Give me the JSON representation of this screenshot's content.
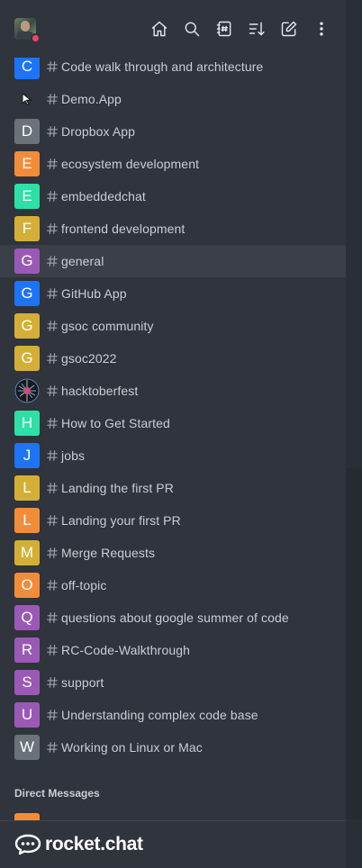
{
  "header": {
    "actions": [
      {
        "name": "home-icon"
      },
      {
        "name": "search-icon"
      },
      {
        "name": "directory-icon"
      },
      {
        "name": "sort-icon"
      },
      {
        "name": "create-new-icon"
      },
      {
        "name": "kebab-menu-icon"
      }
    ],
    "status_color": "#f5455c"
  },
  "rooms": [
    {
      "letter": "C",
      "color": "#1d74f5",
      "name": "Code walk through and architecture"
    },
    {
      "letter": "",
      "color": "#2f343d",
      "name": "Demo.App",
      "icon": "cursor-icon"
    },
    {
      "letter": "D",
      "color": "#6c727a",
      "name": "Dropbox App"
    },
    {
      "letter": "E",
      "color": "#f38c39",
      "name": "ecosystem development"
    },
    {
      "letter": "E",
      "color": "#2de0a5",
      "name": "embeddedchat"
    },
    {
      "letter": "F",
      "color": "#d4af37",
      "name": "frontend development"
    },
    {
      "letter": "G",
      "color": "#9b59b6",
      "name": "general",
      "active": true
    },
    {
      "letter": "G",
      "color": "#1d74f5",
      "name": "GitHub App"
    },
    {
      "letter": "G",
      "color": "#d4af37",
      "name": "gsoc community"
    },
    {
      "letter": "G",
      "color": "#d4af37",
      "name": "gsoc2022"
    },
    {
      "letter": "",
      "color": "#1c2a3a",
      "name": "hacktoberfest",
      "icon": "hacktoberfest-logo-icon"
    },
    {
      "letter": "H",
      "color": "#2de0a5",
      "name": "How to Get Started"
    },
    {
      "letter": "J",
      "color": "#1d74f5",
      "name": "jobs"
    },
    {
      "letter": "L",
      "color": "#d4af37",
      "name": "Landing the first PR"
    },
    {
      "letter": "L",
      "color": "#f38c39",
      "name": "Landing your first PR"
    },
    {
      "letter": "M",
      "color": "#d4af37",
      "name": "Merge Requests"
    },
    {
      "letter": "O",
      "color": "#f38c39",
      "name": "off-topic"
    },
    {
      "letter": "Q",
      "color": "#9b59b6",
      "name": "questions about google summer of code"
    },
    {
      "letter": "R",
      "color": "#9b59b6",
      "name": "RC-Code-Walkthrough"
    },
    {
      "letter": "S",
      "color": "#9b59b6",
      "name": "support"
    },
    {
      "letter": "U",
      "color": "#9b59b6",
      "name": "Understanding complex code base"
    },
    {
      "letter": "W",
      "color": "#6c727a",
      "name": "Working on Linux or Mac"
    }
  ],
  "sections": {
    "direct_messages": "Direct Messages"
  },
  "footer": {
    "brand": "rocket.chat"
  }
}
